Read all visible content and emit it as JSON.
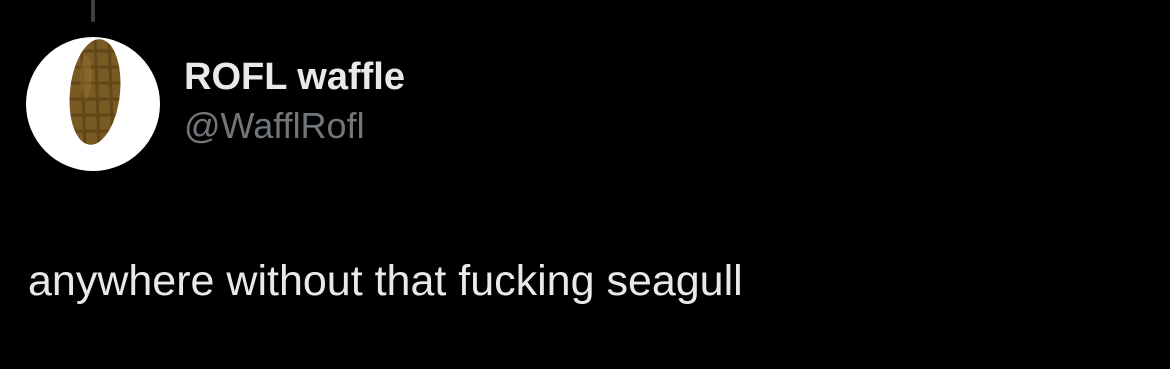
{
  "tweet": {
    "author": {
      "display_name": "ROFL waffle",
      "handle": "@WafflRofl",
      "avatar_icon": "waffle-icon"
    },
    "text": "anywhere without that fucking seagull"
  },
  "colors": {
    "background": "#000000",
    "primary_text": "#e7e9ea",
    "secondary_text": "#71767b",
    "thread_line": "#3e4144",
    "avatar_bg": "#ffffff",
    "waffle": "#7a5a23"
  }
}
